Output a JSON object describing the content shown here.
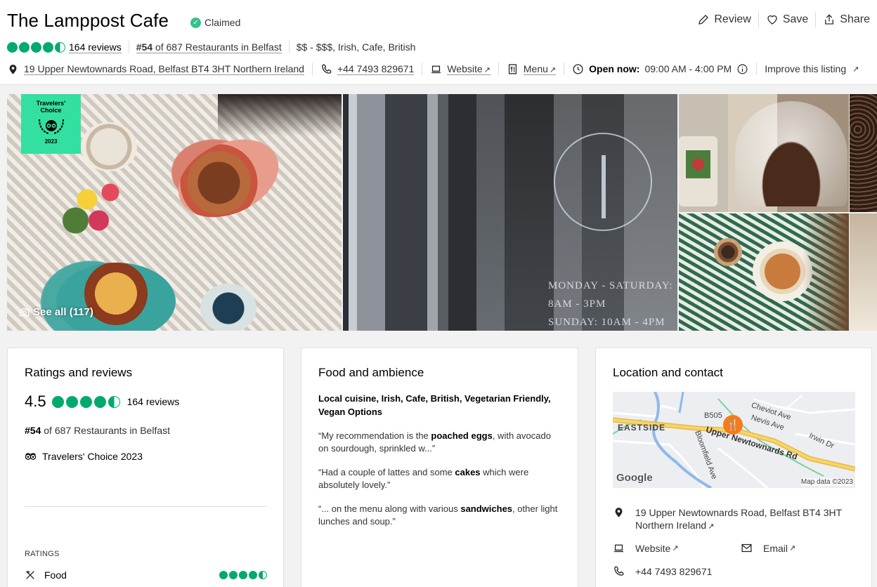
{
  "header": {
    "title": "The Lamppost Cafe",
    "claimed": "Claimed",
    "actions": {
      "review": "Review",
      "save": "Save",
      "share": "Share"
    },
    "rating": {
      "value": 4.5,
      "reviews": "164 reviews"
    },
    "rank": {
      "number": "#54",
      "rest": " of 687 Restaurants in Belfast"
    },
    "price_cuisine": "$$ - $$$, Irish, Cafe, British",
    "address": "19 Upper Newtownards Road, Belfast BT4 3HT Northern Ireland",
    "phone": "+44 7493 829671",
    "website": "Website",
    "menu": "Menu",
    "open_now": "Open now:",
    "hours": "09:00 AM - 4:00 PM",
    "improve": "Improve this listing",
    "arrow": "↗"
  },
  "gallery": {
    "badge": {
      "line1": "Travelers'",
      "line2": "Choice",
      "year": "2023"
    },
    "see_all": "See all (117)",
    "window_hours": [
      "MONDAY - SATURDAY: 8AM - 3PM",
      "SUNDAY: 10AM - 4PM"
    ]
  },
  "ratings_card": {
    "title": "Ratings and reviews",
    "score": "4.5",
    "reviews": "164 reviews",
    "rank_number": "#54",
    "rank_rest": " of 687 Restaurants in Belfast",
    "travelers_choice": "Travelers' Choice 2023",
    "ratings_label": "RATINGS",
    "food_label": "Food",
    "food_rating": 4.5
  },
  "ambience_card": {
    "title": "Food and ambience",
    "tags": "Local cuisine, Irish, Cafe, British, Vegetarian Friendly, Vegan Options",
    "quotes": [
      {
        "pre": "“My recommendation is the ",
        "bold": "poached eggs",
        "post": ", with avocado on sourdough, sprinkled w...”"
      },
      {
        "pre": "“Had a couple of lattes and some ",
        "bold": "cakes",
        "post": " which were absolutely lovely.”"
      },
      {
        "pre": "“... on the menu along with various ",
        "bold": "sandwiches",
        "post": ", other light lunches and soup.”"
      }
    ]
  },
  "location_card": {
    "title": "Location and contact",
    "map": {
      "eastside": "EASTSIDE",
      "road_main": "Upper Newtownards Rd",
      "road_b505": "B505",
      "road_cheviot": "Cheviot Ave",
      "road_nevis": "Nevis Ave",
      "road_irwin": "Irwin Dr",
      "road_bloomfield": "Bloomfield Ave",
      "google": "Google",
      "map_data": "Map data ©2023"
    },
    "address_line1": "19 Upper Newtownards Road, Belfast BT4 3HT",
    "address_line2": "Northern Ireland",
    "website": "Website",
    "email": "Email",
    "phone": "+44 7493 829671"
  },
  "colors": {
    "accent_green": "#00aa6c",
    "badge_green": "#34e0a1",
    "pin_orange": "#f37b1d"
  }
}
